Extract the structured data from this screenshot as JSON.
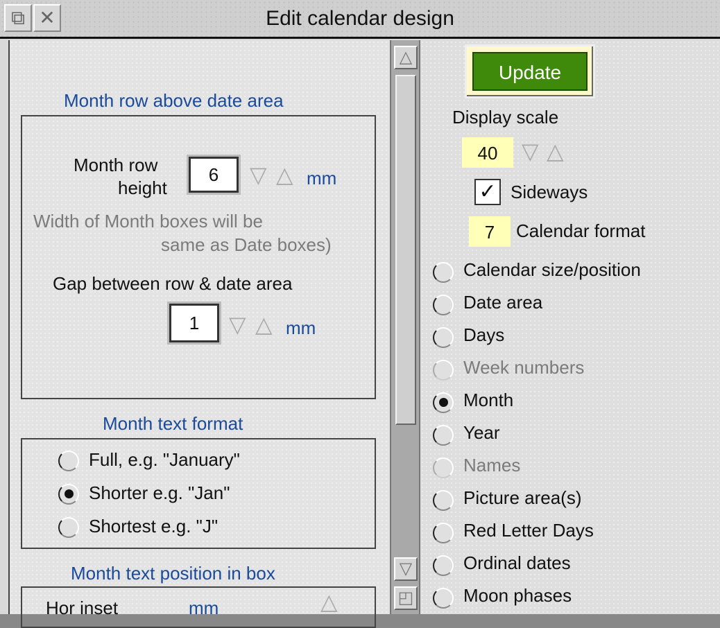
{
  "window": {
    "title": "Edit calendar design"
  },
  "left": {
    "month_row_title": "Month row above date area",
    "month_row_height_label_1": "Month row",
    "month_row_height_label_2": "height",
    "month_row_height_value": "6",
    "unit_mm": "mm",
    "width_note_1": "Width of Month boxes will be",
    "width_note_2": "same as Date boxes)",
    "gap_label": "Gap between row & date area",
    "gap_value": "1",
    "text_format_title": "Month text format",
    "formats": [
      {
        "label": "Full, e.g. \"January\"",
        "selected": false
      },
      {
        "label": "Shorter e.g. \"Jan\"",
        "selected": true
      },
      {
        "label": "Shortest e.g. \"J\"",
        "selected": false
      }
    ],
    "position_title": "Month text position in box",
    "hor_inset_label": "Hor inset",
    "hor_inset_unit": "mm"
  },
  "right": {
    "update_label": "Update",
    "display_scale_label": "Display scale",
    "display_scale_value": "40",
    "sideways_label": "Sideways",
    "sideways_checked": true,
    "calendar_format_value": "7",
    "calendar_format_label": "Calendar format",
    "options": [
      {
        "label": "Calendar size/position",
        "selected": false,
        "enabled": true
      },
      {
        "label": "Date area",
        "selected": false,
        "enabled": true
      },
      {
        "label": "Days",
        "selected": false,
        "enabled": true
      },
      {
        "label": "Week numbers",
        "selected": false,
        "enabled": false
      },
      {
        "label": "Month",
        "selected": true,
        "enabled": true
      },
      {
        "label": "Year",
        "selected": false,
        "enabled": true
      },
      {
        "label": "Names",
        "selected": false,
        "enabled": false
      },
      {
        "label": "Picture area(s)",
        "selected": false,
        "enabled": true
      },
      {
        "label": "Red Letter Days",
        "selected": false,
        "enabled": true
      },
      {
        "label": "Ordinal dates",
        "selected": false,
        "enabled": true
      },
      {
        "label": "Moon phases",
        "selected": false,
        "enabled": true
      }
    ]
  },
  "icons": {
    "back": "back-icon",
    "close": "close-icon",
    "up_arrow": "up-arrow-icon",
    "down_arrow": "down-arrow-icon",
    "resize": "resize-icon"
  }
}
